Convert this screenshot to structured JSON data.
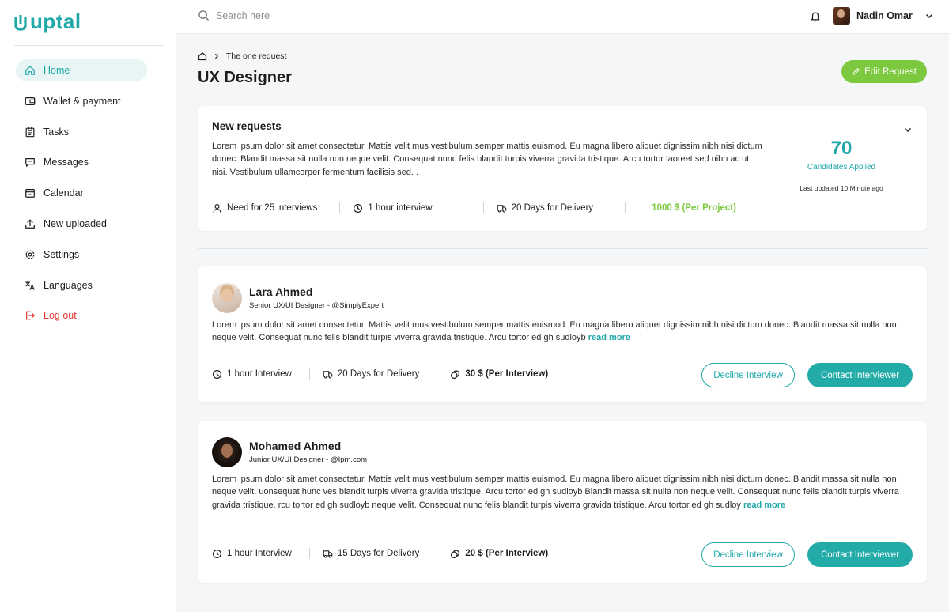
{
  "brand": {
    "logo_text": "uptal"
  },
  "sidebar": {
    "items": [
      {
        "label": "Home"
      },
      {
        "label": "Wallet & payment"
      },
      {
        "label": "Tasks"
      },
      {
        "label": "Messages"
      },
      {
        "label": "Calendar"
      },
      {
        "label": "New uploaded"
      },
      {
        "label": "Settings"
      },
      {
        "label": "Languages"
      },
      {
        "label": "Log out"
      }
    ]
  },
  "topbar": {
    "search_placeholder": "Search here",
    "user_name": "Nadin Omar"
  },
  "breadcrumb": {
    "current": "The one request"
  },
  "page": {
    "title": "UX Designer",
    "edit_label": "Edit Request"
  },
  "request": {
    "title": "New requests",
    "description": "Lorem ipsum dolor sit amet consectetur. Mattis velit mus vestibulum semper mattis euismod. Eu magna libero aliquet dignissim nibh nisi dictum donec. Blandit massa sit nulla non neque velit. Consequat nunc felis blandit turpis viverra gravida tristique. Arcu tortor laoreet sed nibh ac ut nisi. Vestibulum ullamcorper fermentum facilisis sed. .",
    "candidates_count": "70",
    "candidates_label": "Candidates Applied",
    "last_updated": "Last updated 10 Minute ago",
    "interviews": "Need for 25 interviews",
    "duration": "1 hour interview",
    "delivery": "20 Days for Delivery",
    "price": "1000 $ (Per Project)"
  },
  "candidates": [
    {
      "name": "Lara Ahmed",
      "role": "Senior UX/UI Designer - @SimplyExpert",
      "description": "Lorem ipsum dolor sit amet consectetur. Mattis velit mus vestibulum semper mattis euismod. Eu magna libero aliquet dignissim nibh nisi dictum donec. Blandit massa sit nulla non neque velit. Consequat nunc felis blandit turpis viverra gravida tristique. Arcu tortor ed gh sudloyb ",
      "read_more": "read more",
      "duration": "1 hour Interview",
      "delivery": "20 Days for Delivery",
      "price": "30 $ (Per Interview)",
      "decline_label": "Decline Interview",
      "contact_label": "Contact Interviewer"
    },
    {
      "name": "Mohamed Ahmed",
      "role": "Junior UX/UI Designer - @Ipm.com",
      "description": "Lorem ipsum dolor sit amet consectetur. Mattis velit mus vestibulum semper mattis euismod. Eu magna libero aliquet dignissim nibh nisi dictum donec. Blandit massa sit nulla non neque velit. uonsequat hunc ves blandit turpis viverra gravida tristique. Arcu tortor ed gh sudloyb Blandit massa sit nulla non neque velit. Consequat nunc felis blandit turpis viverra gravida tristique. rcu tortor ed gh sudloyb  neque velit. Consequat nunc felis blandit turpis viverra gravida tristique. Arcu tortor ed gh sudloy  ",
      "read_more": "read more",
      "duration": "1 hour Interview",
      "delivery": "15 Days for Delivery",
      "price": "20 $ (Per Interview)",
      "decline_label": "Decline Interview",
      "contact_label": "Contact Interviewer"
    }
  ],
  "icons": {
    "nav": [
      "home-icon",
      "wallet-icon",
      "tasks-icon",
      "messages-icon",
      "calendar-icon",
      "upload-icon",
      "settings-icon",
      "languages-icon",
      "logout-icon"
    ]
  },
  "colors": {
    "accent": "#20a8a8",
    "green": "#7cc940",
    "danger": "#e53935"
  }
}
